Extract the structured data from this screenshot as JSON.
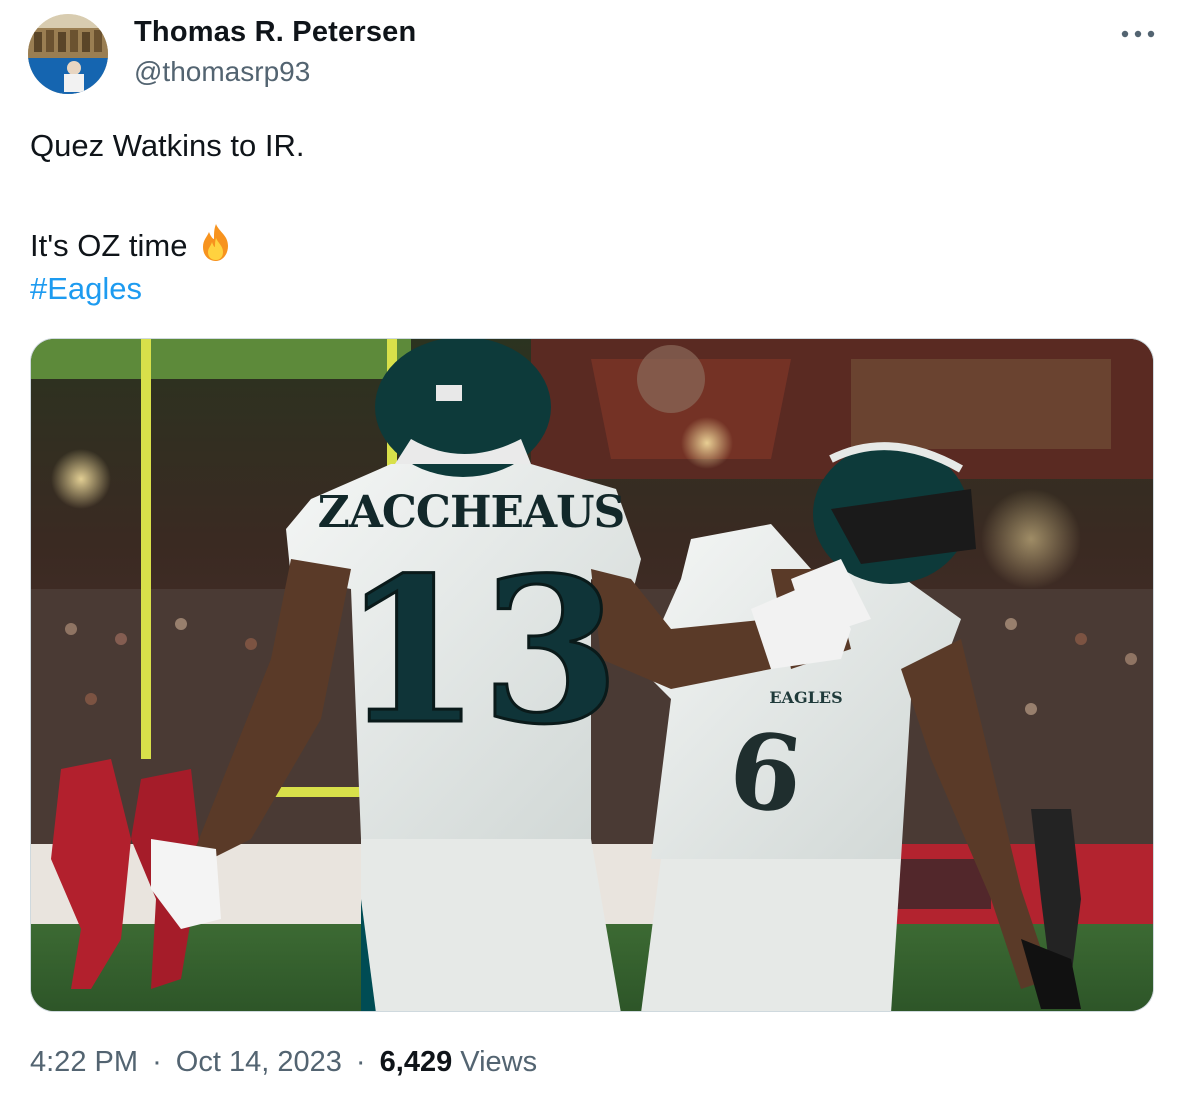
{
  "author": {
    "display_name": "Thomas R. Petersen",
    "handle": "@thomasrp93"
  },
  "tweet": {
    "line1": "Quez Watkins to IR.",
    "line2": "It's OZ time",
    "emoji": "fire-emoji",
    "hashtag": "#Eagles"
  },
  "media": {
    "player1_name": "ZACCHEAUS",
    "player1_number": "13",
    "player2_number": "6",
    "jersey_wordmark": "EAGLES"
  },
  "meta": {
    "time": "4:22 PM",
    "separator": "·",
    "date": "Oct 14, 2023",
    "views_count": "6,429",
    "views_label": "Views"
  },
  "colors": {
    "link": "#1d9bf0",
    "text": "#0f1419",
    "secondary": "#536471",
    "eagles_green": "#004c54"
  }
}
